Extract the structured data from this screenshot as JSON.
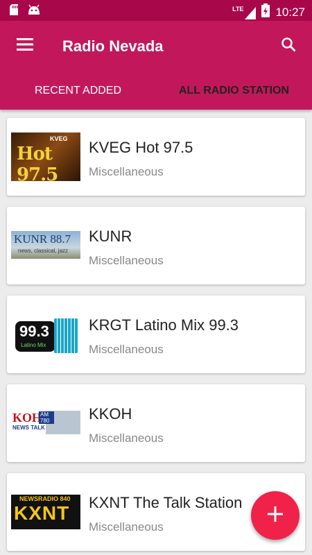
{
  "statusbar": {
    "network": "LTE",
    "time": "10:27"
  },
  "appbar": {
    "title": "Radio Nevada"
  },
  "tabs": [
    {
      "label": "RECENT ADDED",
      "active": true
    },
    {
      "label": "ALL RADIO STATION",
      "active": false
    }
  ],
  "stations": [
    {
      "name": "KVEG Hot 97.5",
      "category": "Miscellaneous",
      "logo_text": "Hot 97.5",
      "logo_sub": "KVEG"
    },
    {
      "name": "KUNR",
      "category": "Miscellaneous",
      "logo_text": "KUNR 88.7",
      "logo_sub": "news, classical, jazz"
    },
    {
      "name": "KRGT Latino Mix 99.3",
      "category": "Miscellaneous",
      "logo_text": "99.3",
      "logo_sub": "Latino Mix"
    },
    {
      "name": "KKOH",
      "category": "Miscellaneous",
      "logo_text": "KOH",
      "logo_sub": "NEWS TALK",
      "logo_badge": "AM 780"
    },
    {
      "name": "KXNT The Talk Station",
      "category": "Miscellaneous",
      "logo_text": "KXNT",
      "logo_sub": "NEWSRADIO 840"
    }
  ],
  "colors": {
    "primary": "#c2185b",
    "statusbar": "#a8084a",
    "fab": "#f0224a"
  },
  "icons": {
    "menu": "hamburger-icon",
    "search": "search-icon",
    "fab": "plus-icon"
  }
}
